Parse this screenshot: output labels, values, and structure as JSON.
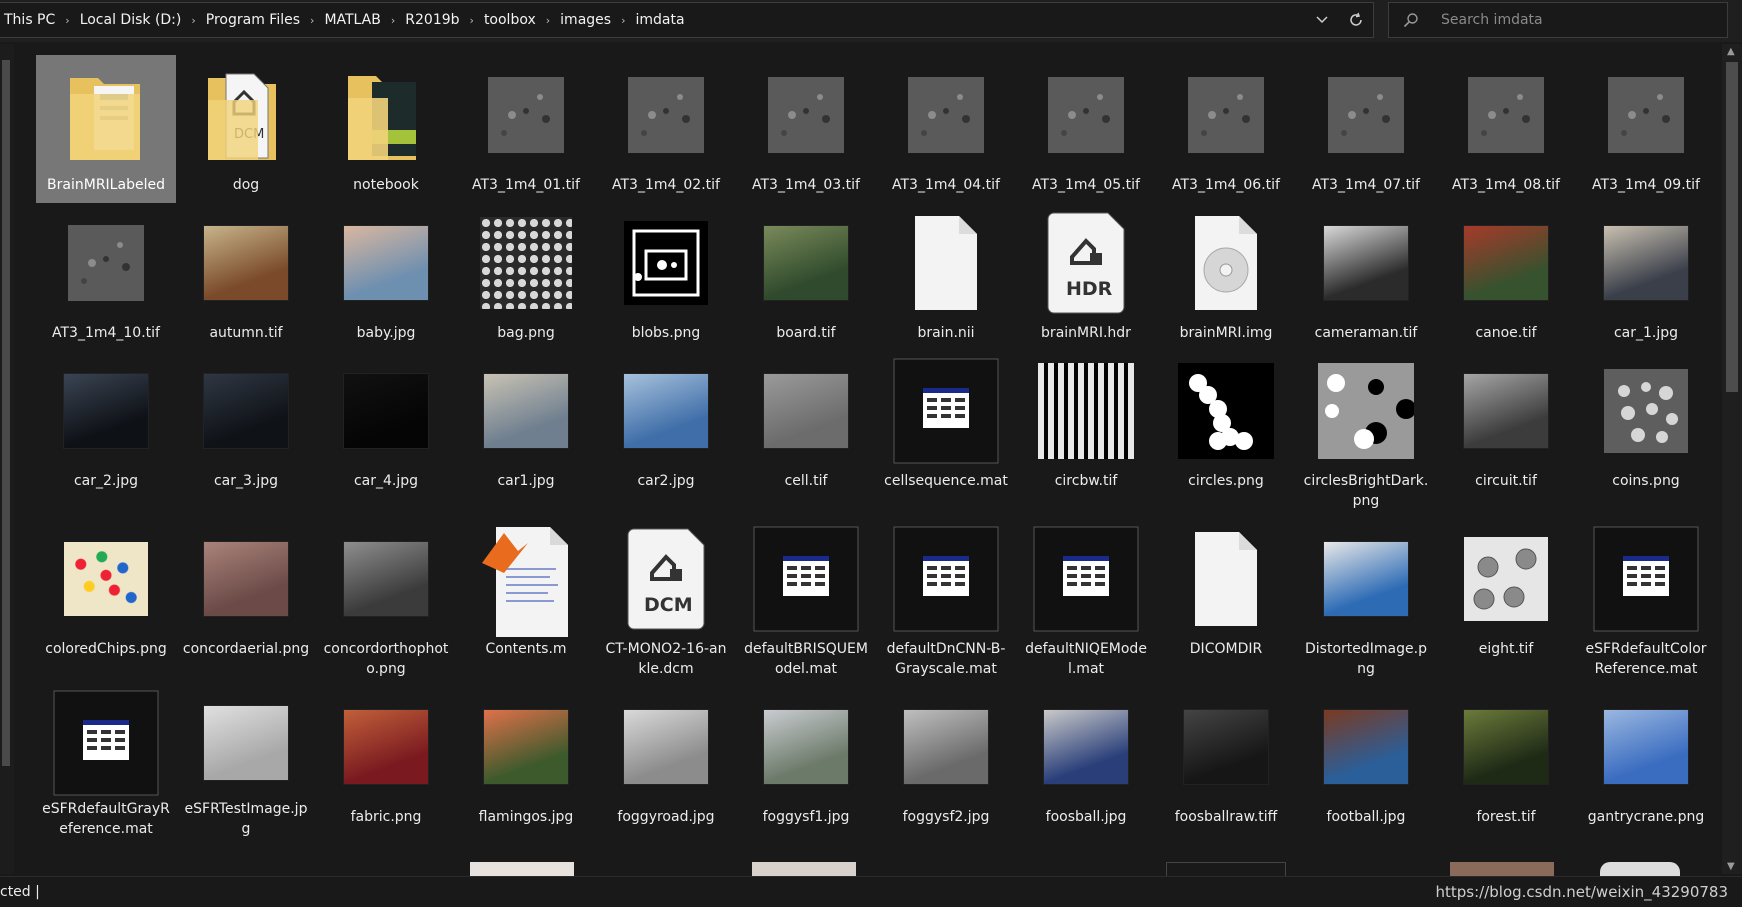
{
  "breadcrumb": [
    "This PC",
    "Local Disk (D:)",
    "Program Files",
    "MATLAB",
    "R2019b",
    "toolbox",
    "images",
    "imdata"
  ],
  "search": {
    "placeholder": "Search imdata"
  },
  "status": {
    "text": "cted  |"
  },
  "watermark": "https://blog.csdn.net/weixin_43290783",
  "files": [
    {
      "name": "BrainMRILabeled",
      "kind": "folder",
      "selected": true
    },
    {
      "name": "dog",
      "kind": "folder-dcm"
    },
    {
      "name": "notebook",
      "kind": "folder-book"
    },
    {
      "name": "AT3_1m4_01.tif",
      "kind": "gray-cells"
    },
    {
      "name": "AT3_1m4_02.tif",
      "kind": "gray-cells"
    },
    {
      "name": "AT3_1m4_03.tif",
      "kind": "gray-cells"
    },
    {
      "name": "AT3_1m4_04.tif",
      "kind": "gray-cells"
    },
    {
      "name": "AT3_1m4_05.tif",
      "kind": "gray-cells"
    },
    {
      "name": "AT3_1m4_06.tif",
      "kind": "gray-cells"
    },
    {
      "name": "AT3_1m4_07.tif",
      "kind": "gray-cells"
    },
    {
      "name": "AT3_1m4_08.tif",
      "kind": "gray-cells"
    },
    {
      "name": "AT3_1m4_09.tif",
      "kind": "gray-cells"
    },
    {
      "name": "AT3_1m4_10.tif",
      "kind": "gray-cells"
    },
    {
      "name": "autumn.tif",
      "kind": "photo",
      "c1": "#7a4a2a",
      "c2": "#c7b48a"
    },
    {
      "name": "baby.jpg",
      "kind": "photo",
      "c1": "#6d8fb0",
      "c2": "#d9b7a0"
    },
    {
      "name": "bag.png",
      "kind": "texture"
    },
    {
      "name": "blobs.png",
      "kind": "blobs"
    },
    {
      "name": "board.tif",
      "kind": "photo",
      "c1": "#2f4a2c",
      "c2": "#7a8a5a"
    },
    {
      "name": "brain.nii",
      "kind": "blank-doc"
    },
    {
      "name": "brainMRI.hdr",
      "kind": "hdr"
    },
    {
      "name": "brainMRI.img",
      "kind": "disc-doc"
    },
    {
      "name": "cameraman.tif",
      "kind": "photo",
      "c1": "#2b2b2b",
      "c2": "#d9d9d9"
    },
    {
      "name": "canoe.tif",
      "kind": "photo",
      "c1": "#36522e",
      "c2": "#a63a2a"
    },
    {
      "name": "car_1.jpg",
      "kind": "photo",
      "c1": "#3a3f4a",
      "c2": "#c9c0b0"
    },
    {
      "name": "car_2.jpg",
      "kind": "photo",
      "c1": "#0e1116",
      "c2": "#3a4453"
    },
    {
      "name": "car_3.jpg",
      "kind": "photo",
      "c1": "#0f1217",
      "c2": "#2f3743"
    },
    {
      "name": "car_4.jpg",
      "kind": "photo",
      "c1": "#050505",
      "c2": "#111"
    },
    {
      "name": "car1.jpg",
      "kind": "photo",
      "c1": "#6f7f8f",
      "c2": "#c8c2b4"
    },
    {
      "name": "car2.jpg",
      "kind": "photo",
      "c1": "#3f6ea8",
      "c2": "#a7c1dc"
    },
    {
      "name": "cell.tif",
      "kind": "photo",
      "c1": "#6c6c6c",
      "c2": "#9a9a9a"
    },
    {
      "name": "cellsequence.mat",
      "kind": "mat"
    },
    {
      "name": "circbw.tif",
      "kind": "circbw"
    },
    {
      "name": "circles.png",
      "kind": "circles"
    },
    {
      "name": "circlesBrightDark.png",
      "kind": "circlesbd"
    },
    {
      "name": "circuit.tif",
      "kind": "photo",
      "c1": "#3c3c3c",
      "c2": "#a5a5a5"
    },
    {
      "name": "coins.png",
      "kind": "coins"
    },
    {
      "name": "coloredChips.png",
      "kind": "chips"
    },
    {
      "name": "concordaerial.png",
      "kind": "photo",
      "c1": "#6b4a47",
      "c2": "#a9837a"
    },
    {
      "name": "concordorthophoto.png",
      "kind": "photo",
      "c1": "#3b3b3b",
      "c2": "#8e8e8e"
    },
    {
      "name": "Contents.m",
      "kind": "mfile"
    },
    {
      "name": "CT-MONO2-16-ankle.dcm",
      "kind": "dcm"
    },
    {
      "name": "defaultBRISQUEModel.mat",
      "kind": "mat"
    },
    {
      "name": "defaultDnCNN-B-Grayscale.mat",
      "kind": "mat"
    },
    {
      "name": "defaultNIQEModel.mat",
      "kind": "mat"
    },
    {
      "name": "DICOMDIR",
      "kind": "blank-doc"
    },
    {
      "name": "DistortedImage.png",
      "kind": "photo",
      "c1": "#2d6bb5",
      "c2": "#e8e8e8"
    },
    {
      "name": "eight.tif",
      "kind": "eight"
    },
    {
      "name": "eSFRdefaultColorReference.mat",
      "kind": "mat"
    },
    {
      "name": "eSFRdefaultGrayReference.mat",
      "kind": "mat"
    },
    {
      "name": "eSFRTestImage.jpg",
      "kind": "photo",
      "c1": "#a8a8a8",
      "c2": "#e0e0e0"
    },
    {
      "name": "fabric.png",
      "kind": "photo",
      "c1": "#7a1a20",
      "c2": "#c1603a"
    },
    {
      "name": "flamingos.jpg",
      "kind": "photo",
      "c1": "#3d5a2c",
      "c2": "#e0714a"
    },
    {
      "name": "foggyroad.jpg",
      "kind": "photo",
      "c1": "#8c8c8c",
      "c2": "#d9d9d9"
    },
    {
      "name": "foggysf1.jpg",
      "kind": "photo",
      "c1": "#6c7a6a",
      "c2": "#c9ccd0"
    },
    {
      "name": "foggysf2.jpg",
      "kind": "photo",
      "c1": "#6a6a6a",
      "c2": "#bfbfbf"
    },
    {
      "name": "foosball.jpg",
      "kind": "photo",
      "c1": "#2a3f7a",
      "c2": "#c9c9c9"
    },
    {
      "name": "foosballraw.tiff",
      "kind": "photo",
      "c1": "#161616",
      "c2": "#444"
    },
    {
      "name": "football.jpg",
      "kind": "photo",
      "c1": "#2a5f9a",
      "c2": "#7a3a22"
    },
    {
      "name": "forest.tif",
      "kind": "photo",
      "c1": "#1f2a16",
      "c2": "#6b7a3a"
    },
    {
      "name": "gantrycrane.png",
      "kind": "photo",
      "c1": "#3a6cc0",
      "c2": "#9ab7e0"
    }
  ]
}
